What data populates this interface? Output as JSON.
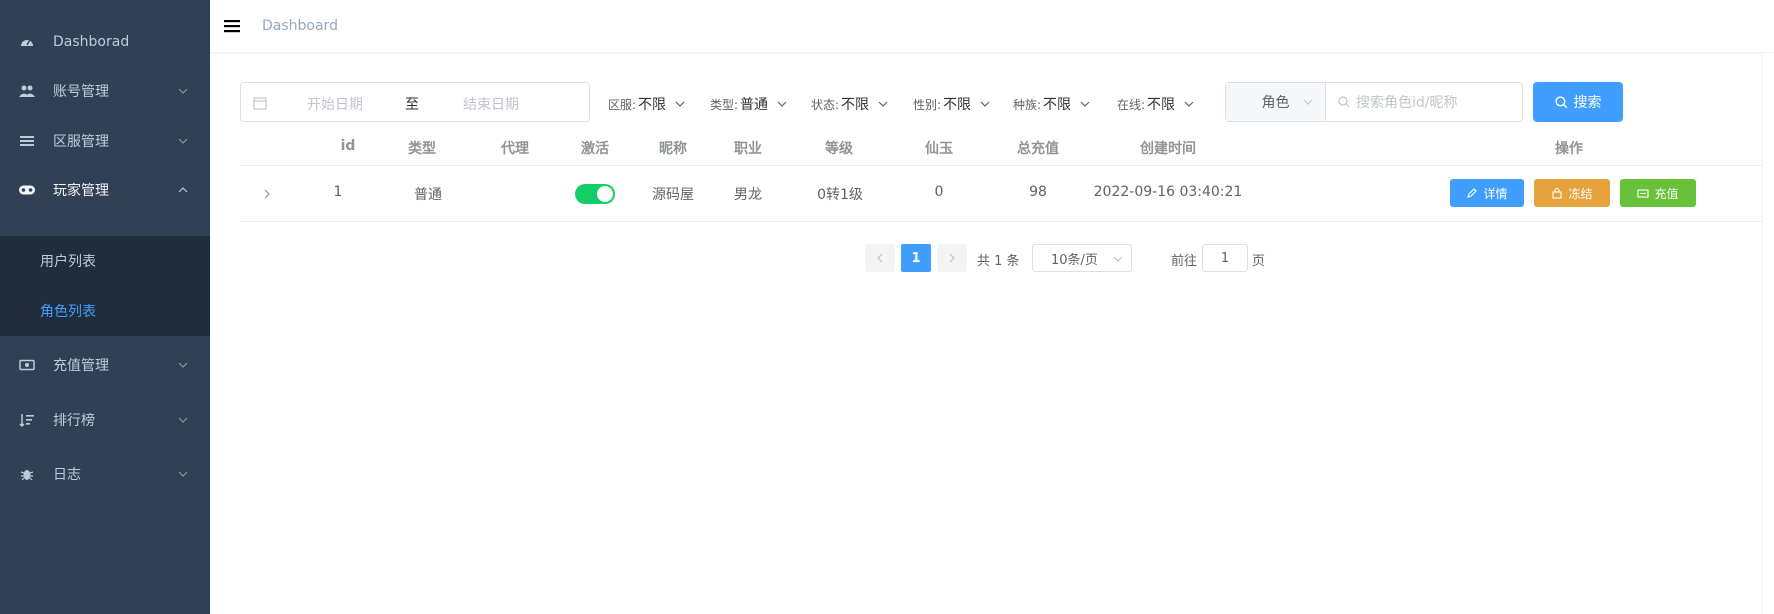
{
  "sidebar": {
    "items": [
      {
        "label": "Dashborad",
        "icon": "dashboard-icon"
      },
      {
        "label": "账号管理",
        "icon": "users-icon"
      },
      {
        "label": "区服管理",
        "icon": "server-list-icon"
      },
      {
        "label": "玩家管理",
        "icon": "gamepad-icon"
      },
      {
        "label": "充值管理",
        "icon": "money-icon"
      },
      {
        "label": "排行榜",
        "icon": "sort-icon"
      },
      {
        "label": "日志",
        "icon": "bug-icon"
      }
    ],
    "submenu": [
      {
        "label": "用户列表"
      },
      {
        "label": "角色列表"
      }
    ]
  },
  "topbar": {
    "breadcrumb": "Dashboard"
  },
  "filters": {
    "date_start_placeholder": "开始日期",
    "date_separator": "至",
    "date_end_placeholder": "结束日期",
    "server_label": "区服:",
    "server_value": "不限",
    "type_label": "类型:",
    "type_value": "普通",
    "status_label": "状态:",
    "status_value": "不限",
    "gender_label": "性别:",
    "gender_value": "不限",
    "race_label": "种族:",
    "race_value": "不限",
    "online_label": "在线:",
    "online_value": "不限",
    "search_scope": "角色",
    "search_placeholder": "搜索角色id/昵称",
    "search_button": "搜索"
  },
  "table": {
    "headers": [
      "id",
      "类型",
      "代理",
      "激活",
      "昵称",
      "职业",
      "等级",
      "仙玉",
      "总充值",
      "创建时间",
      "操作"
    ],
    "rows": [
      {
        "id": "1",
        "type": "普通",
        "agent": "",
        "active": true,
        "nickname": "源码屋",
        "job": "男龙",
        "level": "0转1级",
        "jade": "0",
        "total_recharge": "98",
        "created_at": "2022-09-16 03:40:21",
        "actions": {
          "detail": "详情",
          "freeze": "冻结",
          "recharge": "充值"
        }
      }
    ]
  },
  "pagination": {
    "current_page": "1",
    "total": "共 1 条",
    "page_size": "10条/页",
    "goto_label": "前往",
    "goto_value": "1",
    "page_unit": "页"
  },
  "colors": {
    "sidebar_bg": "#304156",
    "submenu_bg": "#1f2d3d",
    "primary": "#409eff",
    "success": "#67c23a",
    "warning": "#e6a23c",
    "switch_on": "#13ce66"
  }
}
